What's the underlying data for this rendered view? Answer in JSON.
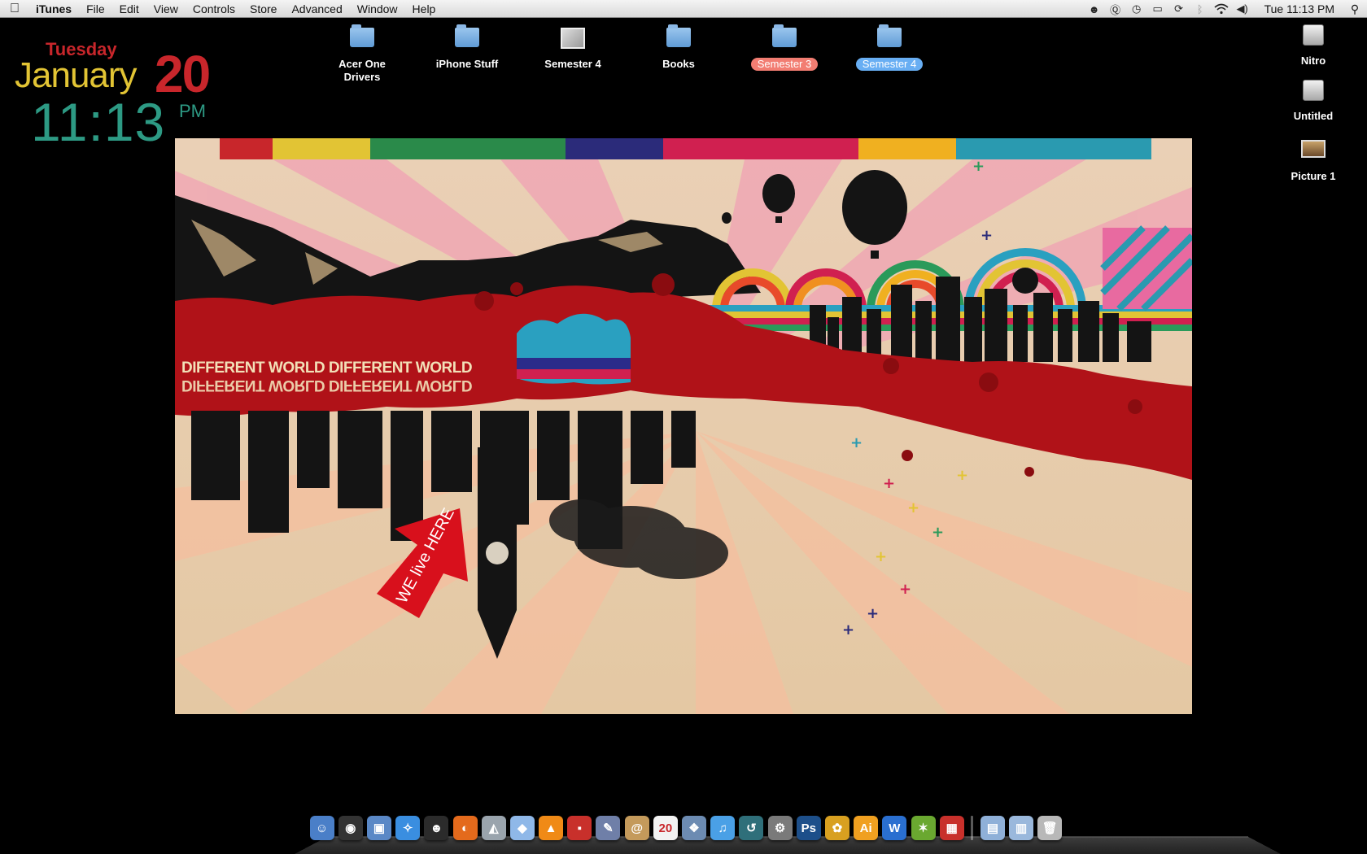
{
  "menubar": {
    "app_name": "iTunes",
    "menus": [
      "File",
      "Edit",
      "View",
      "Controls",
      "Store",
      "Advanced",
      "Window",
      "Help"
    ],
    "clock": "Tue 11:13 PM",
    "status_icons": [
      "skype-icon",
      "quicksilver-icon",
      "time-machine-icon",
      "display-icon",
      "sync-icon",
      "bluetooth-icon",
      "wifi-icon",
      "volume-icon"
    ]
  },
  "date_widget": {
    "weekday": "Tuesday",
    "month": "January",
    "day": "20",
    "time": "11:13",
    "ampm": "PM"
  },
  "desktop_icons": [
    {
      "label": "Acer One Drivers",
      "type": "folder",
      "tag": ""
    },
    {
      "label": "iPhone Stuff",
      "type": "folder",
      "tag": ""
    },
    {
      "label": "Semester 4",
      "type": "image",
      "tag": ""
    },
    {
      "label": "Books",
      "type": "folder",
      "tag": ""
    },
    {
      "label": "Semester 3",
      "type": "folder",
      "tag": "red"
    },
    {
      "label": "Semester 4",
      "type": "folder",
      "tag": "blue"
    },
    {
      "label": "Nitro",
      "type": "drive",
      "tag": ""
    },
    {
      "label": "Untitled",
      "type": "drive",
      "tag": ""
    },
    {
      "label": "Picture 1",
      "type": "picture",
      "tag": ""
    }
  ],
  "wallpaper": {
    "headline": "DIFFERENT WORLD DIFFERENT WORLD",
    "headline_mirror": "DIFFERENT WORLD DIFFERENT WORLD",
    "arrow_text": "WE live HERE"
  },
  "dock": {
    "apps": [
      {
        "name": "finder-icon",
        "color": "#4a7fc8",
        "glyph": "☺"
      },
      {
        "name": "dashboard-icon",
        "color": "#333333",
        "glyph": "◉"
      },
      {
        "name": "preview-icon",
        "color": "#5a88c6",
        "glyph": "▣"
      },
      {
        "name": "safari-icon",
        "color": "#3a8ee0",
        "glyph": "✧"
      },
      {
        "name": "adium-icon",
        "color": "#2b2b2b",
        "glyph": "☻"
      },
      {
        "name": "firefox-icon",
        "color": "#e46a1c",
        "glyph": "◐"
      },
      {
        "name": "airport-icon",
        "color": "#9aa4ad",
        "glyph": "◭"
      },
      {
        "name": "virtualbox-icon",
        "color": "#8fb8e8",
        "glyph": "◆"
      },
      {
        "name": "vlc-icon",
        "color": "#f08a16",
        "glyph": "▲"
      },
      {
        "name": "photo-booth-icon",
        "color": "#c8302b",
        "glyph": "▪"
      },
      {
        "name": "script-editor-icon",
        "color": "#6f7fa8",
        "glyph": "✎"
      },
      {
        "name": "address-book-icon",
        "color": "#c49a5b",
        "glyph": "@"
      },
      {
        "name": "ical-icon",
        "color": "#f2f2f2",
        "glyph": "20"
      },
      {
        "name": "iphoto-icon",
        "color": "#6c8bb2",
        "glyph": "❖"
      },
      {
        "name": "itunes-icon",
        "color": "#4aa0e6",
        "glyph": "♫"
      },
      {
        "name": "time-machine-icon",
        "color": "#2f6f7a",
        "glyph": "↺"
      },
      {
        "name": "system-preferences-icon",
        "color": "#7a7a7a",
        "glyph": "⚙"
      },
      {
        "name": "photoshop-icon",
        "color": "#1d4f8a",
        "glyph": "Ps"
      },
      {
        "name": "pineapple-icon",
        "color": "#d8a020",
        "glyph": "✿"
      },
      {
        "name": "illustrator-icon",
        "color": "#f0a020",
        "glyph": "Ai"
      },
      {
        "name": "word-icon",
        "color": "#2a6fd0",
        "glyph": "W"
      },
      {
        "name": "dreamweaver-icon",
        "color": "#6aa830",
        "glyph": "✶"
      },
      {
        "name": "parallels-icon",
        "color": "#c8302b",
        "glyph": "▦"
      },
      {
        "name": "separator",
        "color": "",
        "glyph": ""
      },
      {
        "name": "documents-stack-icon",
        "color": "#8fb0d8",
        "glyph": "▤"
      },
      {
        "name": "downloads-stack-icon",
        "color": "#9ab8dc",
        "glyph": "▥"
      },
      {
        "name": "trash-icon",
        "color": "#b8b8b8",
        "glyph": "🗑"
      }
    ]
  }
}
